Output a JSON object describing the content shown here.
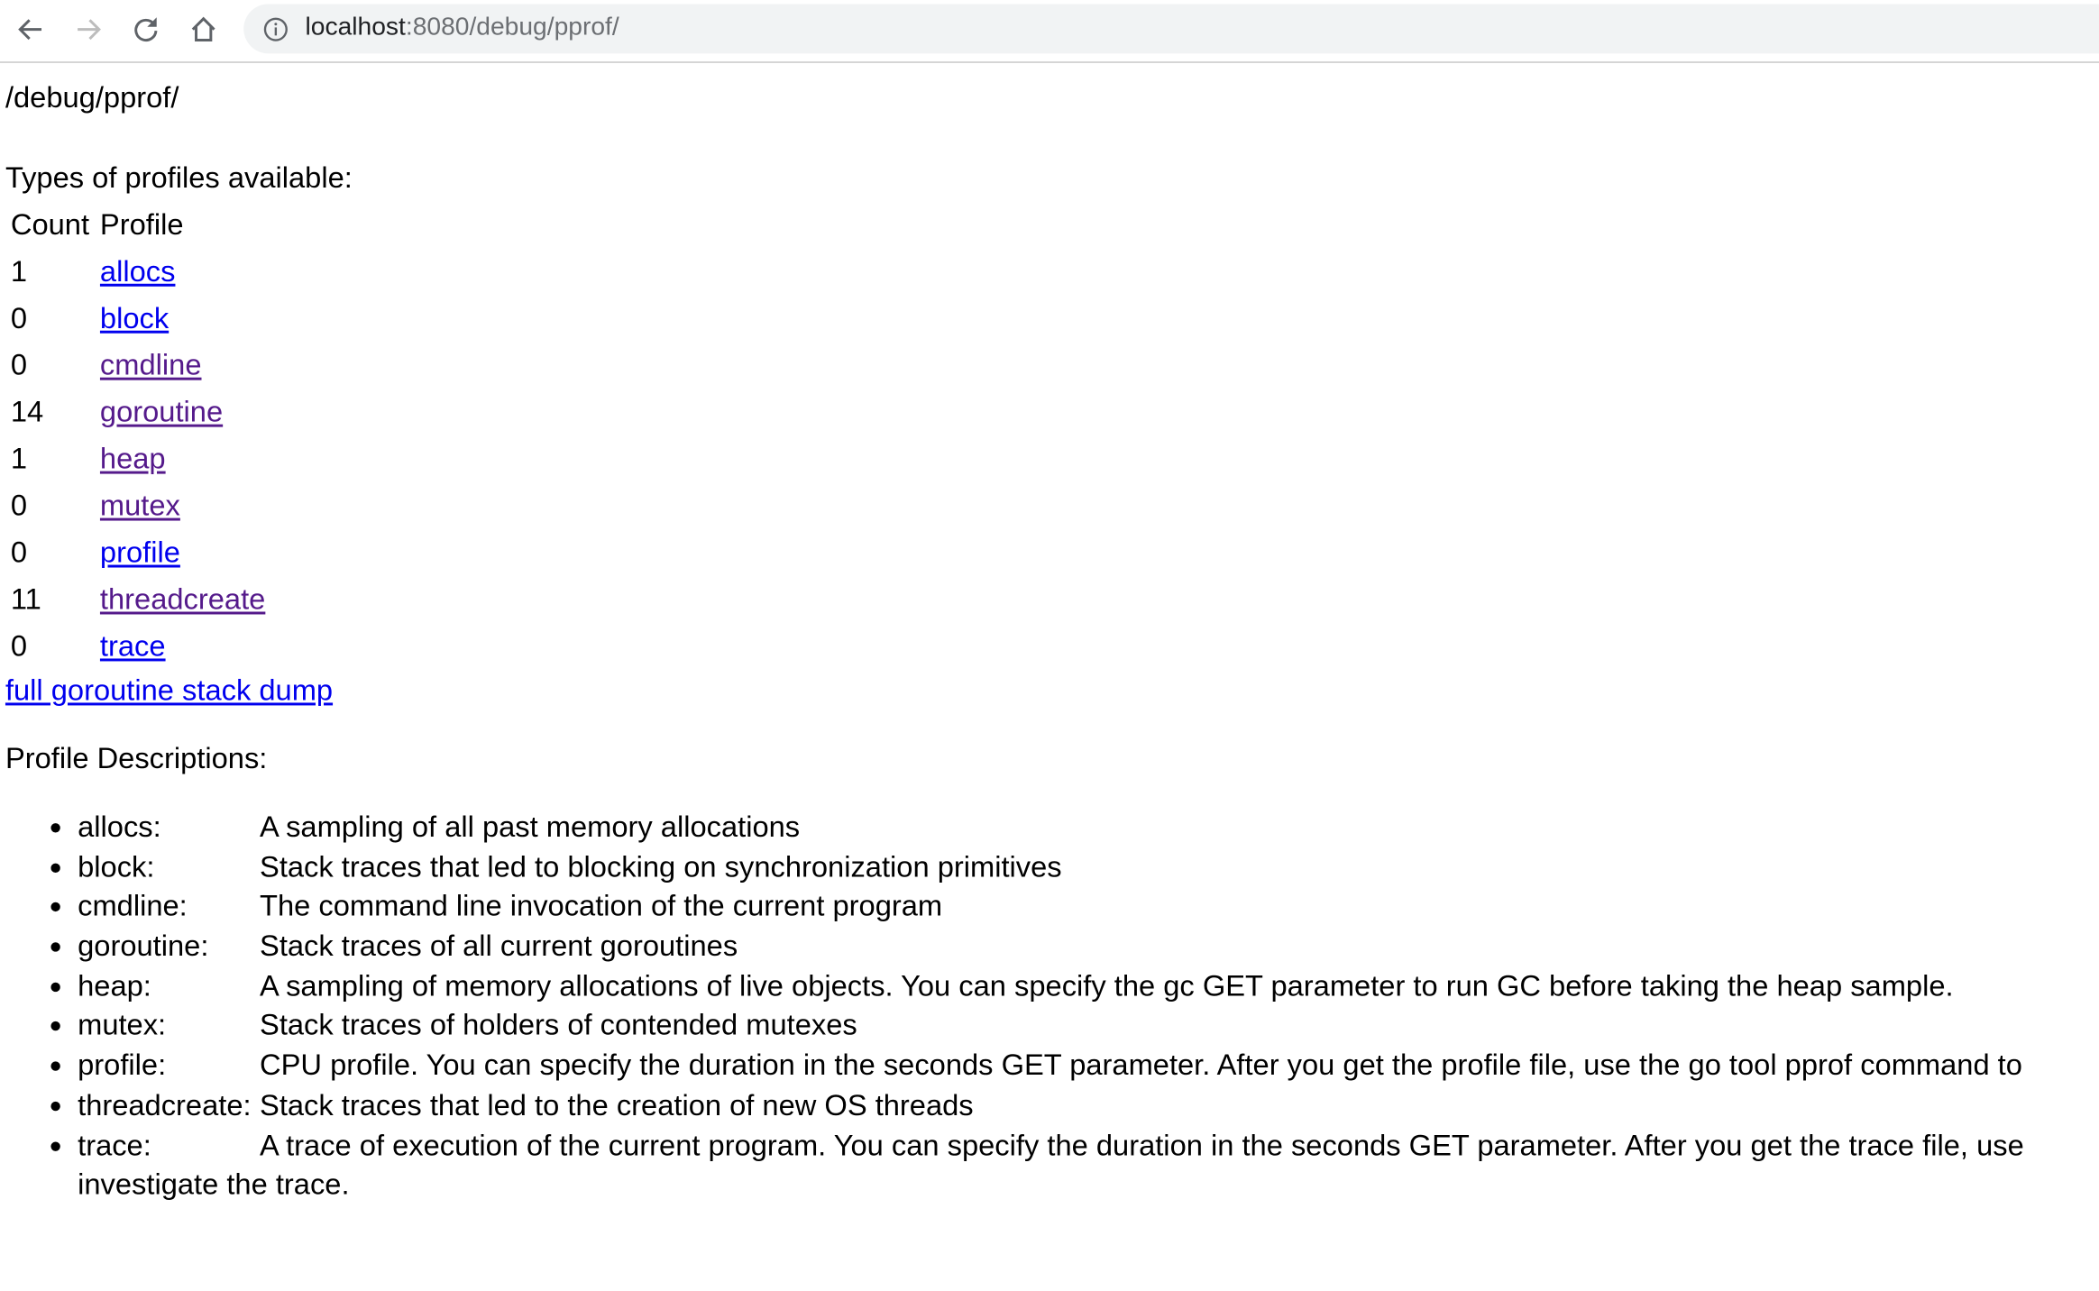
{
  "browser": {
    "url_host": "localhost",
    "url_rest": ":8080/debug/pprof/",
    "icons": [
      "back-icon",
      "forward-icon",
      "reload-icon",
      "home-icon",
      "info-icon"
    ]
  },
  "page": {
    "title": "/debug/pprof/",
    "types_heading": "Types of profiles available:",
    "table": {
      "headers": [
        "Count",
        "Profile"
      ],
      "rows": [
        {
          "count": "1",
          "profile": "allocs",
          "visited": false
        },
        {
          "count": "0",
          "profile": "block",
          "visited": false
        },
        {
          "count": "0",
          "profile": "cmdline",
          "visited": true
        },
        {
          "count": "14",
          "profile": "goroutine",
          "visited": true
        },
        {
          "count": "1",
          "profile": "heap",
          "visited": true
        },
        {
          "count": "0",
          "profile": "mutex",
          "visited": true
        },
        {
          "count": "0",
          "profile": "profile",
          "visited": false
        },
        {
          "count": "11",
          "profile": "threadcreate",
          "visited": true
        },
        {
          "count": "0",
          "profile": "trace",
          "visited": false
        }
      ]
    },
    "dump_link": "full goroutine stack dump",
    "descriptions_heading": "Profile Descriptions:",
    "descriptions": [
      {
        "name": "allocs:",
        "text": "A sampling of all past memory allocations"
      },
      {
        "name": "block:",
        "text": "Stack traces that led to blocking on synchronization primitives"
      },
      {
        "name": "cmdline:",
        "text": "The command line invocation of the current program"
      },
      {
        "name": "goroutine:",
        "text": "Stack traces of all current goroutines"
      },
      {
        "name": "heap:",
        "text": "A sampling of memory allocations of live objects. You can specify the gc GET parameter to run GC before taking the heap sample."
      },
      {
        "name": "mutex:",
        "text": "Stack traces of holders of contended mutexes"
      },
      {
        "name": "profile:",
        "text": "CPU profile. You can specify the duration in the seconds GET parameter. After you get the profile file, use the go tool pprof command to"
      },
      {
        "name": "threadcreate:",
        "text": "Stack traces that led to the creation of new OS threads"
      },
      {
        "name": "trace:",
        "text": "A trace of execution of the current program. You can specify the duration in the seconds GET parameter. After you get the trace file, use",
        "text2": "investigate the trace."
      }
    ],
    "colors": {
      "link": "#0000ee",
      "visited": "#551a8b"
    }
  }
}
